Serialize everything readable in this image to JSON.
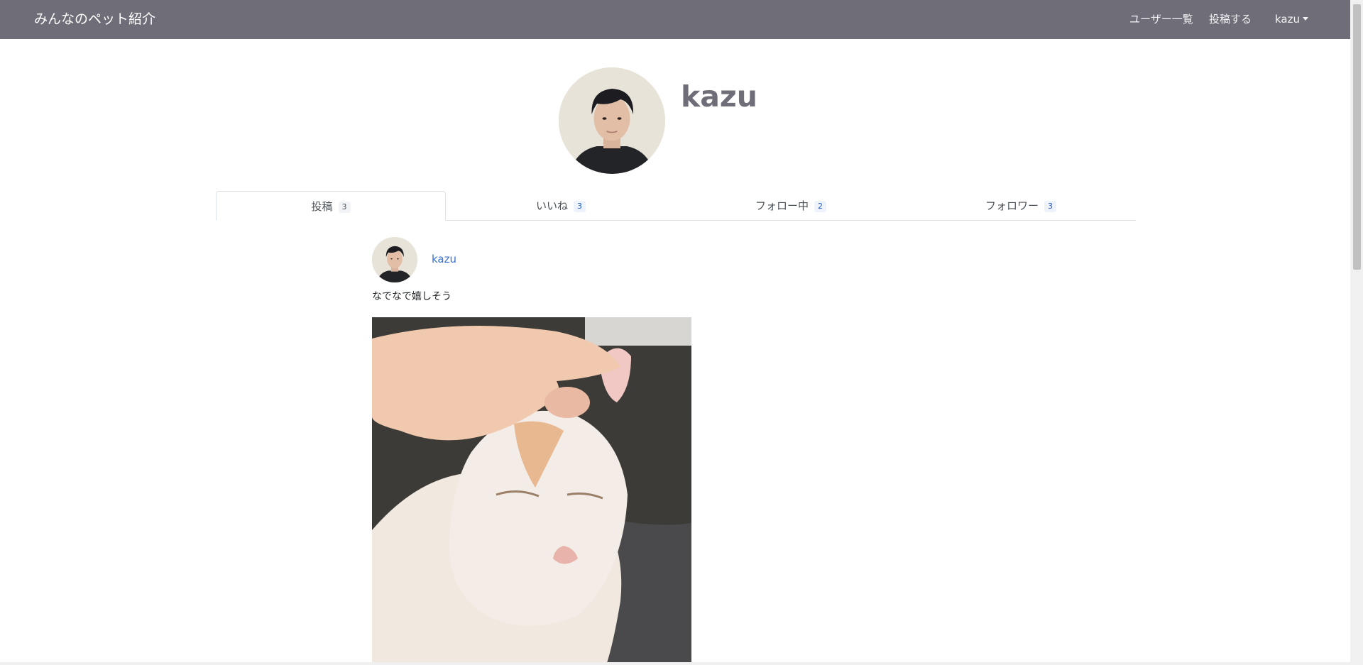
{
  "navbar": {
    "brand": "みんなのペット紹介",
    "links": {
      "users": "ユーザー一覧",
      "post": "投稿する",
      "account": "kazu"
    }
  },
  "profile": {
    "name": "kazu"
  },
  "tabs": [
    {
      "label": "投稿",
      "count": "3",
      "active": true
    },
    {
      "label": "いいね",
      "count": "3",
      "active": false
    },
    {
      "label": "フォロー中",
      "count": "2",
      "active": false
    },
    {
      "label": "フォロワー",
      "count": "3",
      "active": false
    }
  ],
  "post": {
    "user": "kazu",
    "text": "なでなで嬉しそう"
  },
  "colors": {
    "navbar": "#6f6d78",
    "link": "#3b6fd1",
    "badge_text": "#2361ce"
  }
}
